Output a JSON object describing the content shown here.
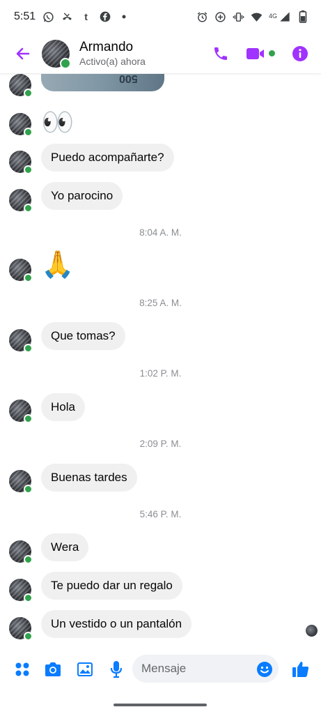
{
  "status_bar": {
    "time": "5:51",
    "network": "4G",
    "left_icons": [
      "whatsapp-icon",
      "missed-call-icon",
      "tumblr-icon",
      "facebook-icon",
      "dot-icon"
    ],
    "right_icons": [
      "alarm-icon",
      "data-saver-icon",
      "vibrate-icon",
      "wifi-icon",
      "signal-icon",
      "battery-icon"
    ]
  },
  "header": {
    "contact_name": "Armando",
    "status": "Activo(a) ahora",
    "actions": [
      "phone-icon",
      "video-call-icon",
      "info-icon"
    ],
    "accent_color": "#a033ff"
  },
  "chat": {
    "image_text": "500",
    "messages": [
      {
        "type": "emoji",
        "text": "👀"
      },
      {
        "type": "text",
        "text": "Puedo acompañarte?"
      },
      {
        "type": "text",
        "text": "Yo parocino"
      },
      {
        "type": "time",
        "text": "8:04 A. M."
      },
      {
        "type": "emoji",
        "text": "🙏"
      },
      {
        "type": "time",
        "text": "8:25 A. M."
      },
      {
        "type": "text",
        "text": "Que tomas?"
      },
      {
        "type": "time",
        "text": "1:02 P. M."
      },
      {
        "type": "text",
        "text": "Hola"
      },
      {
        "type": "time",
        "text": "2:09 P. M."
      },
      {
        "type": "text",
        "text": "Buenas tardes"
      },
      {
        "type": "time",
        "text": "5:46 P. M."
      },
      {
        "type": "text",
        "text": "Wera"
      },
      {
        "type": "text",
        "text": "Te puedo dar un regalo"
      },
      {
        "type": "text",
        "text": "Un vestido o un pantalón"
      }
    ]
  },
  "composer": {
    "placeholder": "Mensaje",
    "icons": [
      "menu-dots-icon",
      "camera-icon",
      "gallery-icon",
      "microphone-icon",
      "emoji-icon",
      "like-icon"
    ],
    "accent_color": "#0a7cff"
  }
}
